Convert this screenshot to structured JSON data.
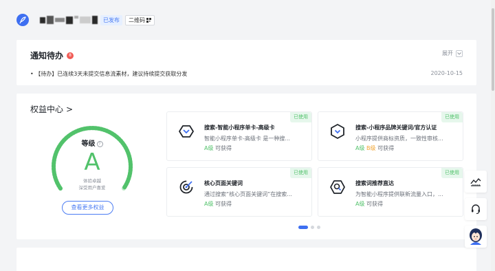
{
  "header": {
    "status_tag": "已发布",
    "qr_button": "二维码",
    "logo_icon": "feather-pen-icon"
  },
  "notice": {
    "title": "通知待办",
    "badge": "8",
    "expand_label": "展开",
    "items": [
      {
        "text": "【待办】已连续3天未提交信息流素材，建议持续提交获取分发",
        "date": "2020-10-15"
      }
    ]
  },
  "rights": {
    "title": "权益中心",
    "title_arrow": ">",
    "grade": {
      "label": "等级",
      "value": "A",
      "desc_line1": "体验卓越",
      "desc_line2": "深受用户喜爱",
      "accent": "#52c26b"
    },
    "more_button": "查看更多权益",
    "cards": [
      {
        "tag": "已使用",
        "name": "搜索-智能小程序单卡-高级卡",
        "desc": "智能小程序单卡-高级卡 是一种搜...",
        "level_a": "A级",
        "level_b": "",
        "suffix": "可获得",
        "icon": "chevron-down-hexagon-icon"
      },
      {
        "tag": "已使用",
        "name": "搜索-小程序品牌关键词/官方认证",
        "desc": "小程序提供商标资质，一致性审核...",
        "level_a": "A级",
        "level_b": "B级",
        "suffix": "可获得",
        "icon": "chevron-down-hexagon-icon"
      },
      {
        "tag": "已使用",
        "name": "核心页面关键词",
        "desc": "通过搜索“核心页面关键词”在搜索...",
        "level_a": "A级",
        "level_b": "",
        "suffix": "可获得",
        "icon": "target-icon"
      },
      {
        "tag": "已使用",
        "name": "搜索词推荐直达",
        "desc": "为智能小程序提供联新流量入口，...",
        "level_a": "A级",
        "level_b": "",
        "suffix": "可获得",
        "icon": "search-hexagon-icon"
      }
    ],
    "pager": {
      "count": 3,
      "active": 1
    }
  },
  "float": {
    "buttons": [
      "chart-icon",
      "headset-icon",
      "assistant-avatar-icon"
    ]
  }
}
